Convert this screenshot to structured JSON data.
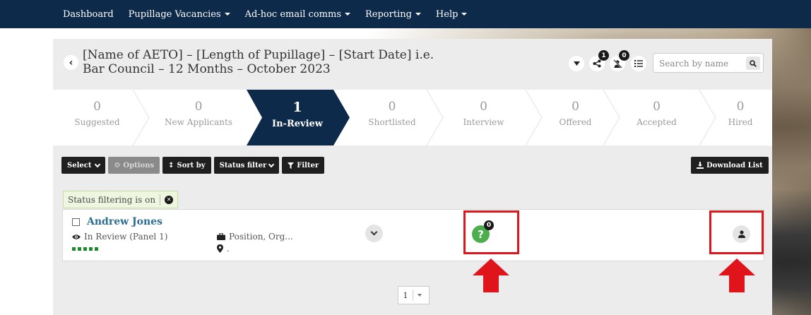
{
  "nav": {
    "items": [
      {
        "label": "Dashboard",
        "dropdown": false
      },
      {
        "label": "Pupillage Vacancies",
        "dropdown": true
      },
      {
        "label": "Ad-hoc email comms",
        "dropdown": true
      },
      {
        "label": "Reporting",
        "dropdown": true
      },
      {
        "label": "Help",
        "dropdown": true
      }
    ]
  },
  "header": {
    "title": "[Name of AETO] – [Length of Pupillage] – [Start Date] i.e. Bar Council – 12 Months – October 2023",
    "share_badge": "1",
    "unassigned_badge": "0",
    "search_placeholder": "Search by name"
  },
  "pipeline": {
    "stages": [
      {
        "count": "0",
        "label": "Suggested"
      },
      {
        "count": "0",
        "label": "New Applicants"
      },
      {
        "count": "1",
        "label": "In-Review",
        "active": true
      },
      {
        "count": "0",
        "label": "Shortlisted"
      },
      {
        "count": "0",
        "label": "Interview"
      },
      {
        "count": "0",
        "label": "Offered"
      },
      {
        "count": "0",
        "label": "Accepted"
      },
      {
        "count": "0",
        "label": "Hired"
      }
    ]
  },
  "toolbar": {
    "select_label": "Select",
    "options_label": "Options",
    "sort_label": "Sort by",
    "status_filter_label": "Status filter",
    "filter_label": "Filter",
    "download_label": "Download List"
  },
  "status_chip": {
    "text": "Status filtering is on"
  },
  "applicant": {
    "name": "Andrew Jones",
    "stage": "In Review (Panel 1)",
    "position": "Position, Org...",
    "location": ".",
    "question_count": "0",
    "progress_dots": 5
  },
  "pager": {
    "current": "1"
  },
  "colors": {
    "nav_bg": "#0d2a4a",
    "active_stage": "#0d2a4a",
    "highlight": "#e0151b",
    "question_badge": "#4cae4c",
    "link": "#2a6d8f"
  }
}
